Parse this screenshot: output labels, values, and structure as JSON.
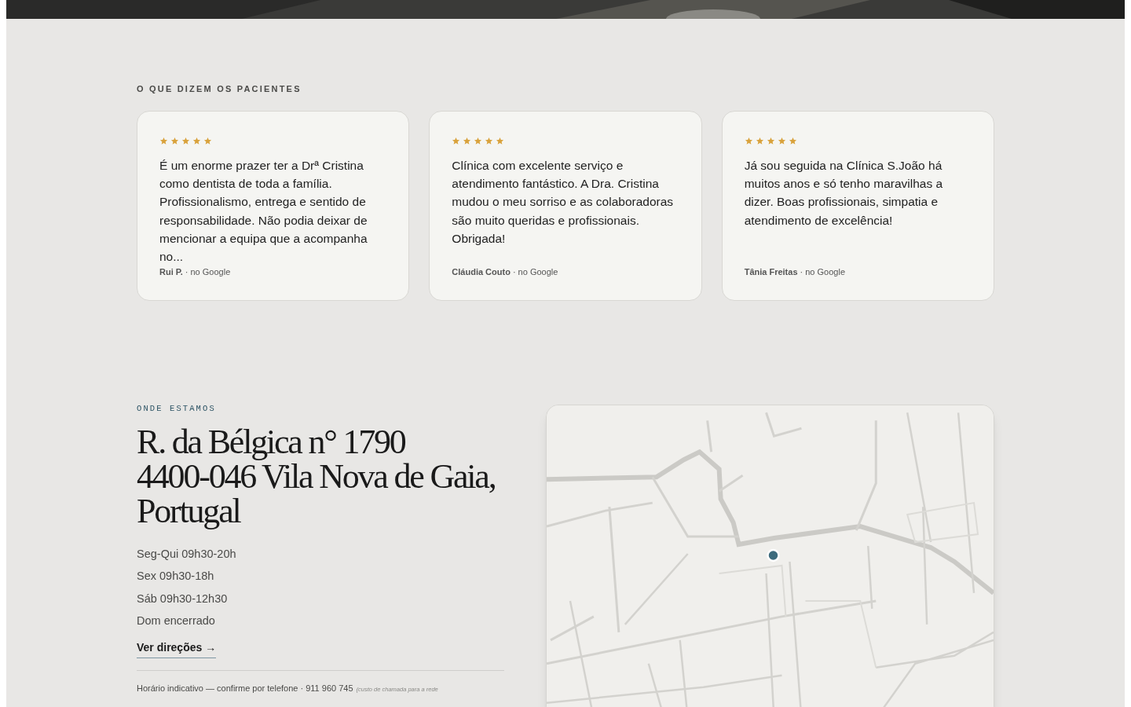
{
  "testimonials": {
    "label": "O QUE DIZEM OS PACIENTES",
    "reviews": [
      {
        "stars": 5,
        "text": "É um enorme prazer ter a Drª Cristina como dentista de toda a família. Profissionalismo, entrega e sentido de responsabilidade. Não podia deixar de mencionar a equipa que a acompanha no...",
        "author": "Rui P.",
        "source": "· no Google"
      },
      {
        "stars": 5,
        "text": "Clínica com excelente serviço e atendimento fantástico. A Dra. Cristina mudou o meu sorriso e as colaboradoras são muito queridas e profissionais. Obrigada!",
        "author": "Cláudia Couto",
        "source": "· no Google"
      },
      {
        "stars": 5,
        "text": "Já sou seguida na Clínica S.João há muitos anos e só tenho maravilhas a dizer. Boas profissionais, simpatia e atendimento de excelência!",
        "author": "Tânia Freitas",
        "source": "· no Google"
      }
    ]
  },
  "location": {
    "label": "ONDE ESTAMOS",
    "address_lines": [
      "R. da Bélgica n° 1790",
      "4400-046 Vila Nova de Gaia,",
      "Portugal"
    ],
    "hours": [
      "Seg-Qui 09h30-20h",
      "Sex 09h30-18h",
      "Sáb 09h30-12h30",
      "Dom encerrado"
    ],
    "directions_link": "Ver direções →",
    "note": "Horário indicativo — confirme por telefone · 911 960 745",
    "note_small": "(custo de chamada para a rede",
    "map": {
      "kind": "picture"
    }
  }
}
